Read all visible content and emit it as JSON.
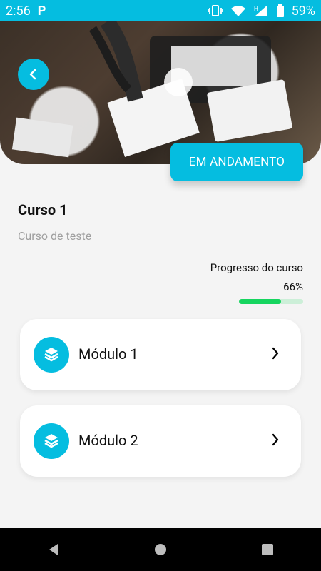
{
  "status_bar": {
    "time": "2:56",
    "app_icon": "P",
    "battery": "59%"
  },
  "header": {
    "back_icon": "chevron-left-icon",
    "image": "business-desk-photo",
    "status_chip": "EM ANDAMENTO"
  },
  "course": {
    "title": "Curso 1",
    "subtitle": "Curso de teste",
    "progress_label": "Progresso do curso",
    "progress_value": "66%",
    "progress_percent": 66
  },
  "modules": [
    {
      "label": "Módulo 1",
      "icon": "layers-icon"
    },
    {
      "label": "Módulo 2",
      "icon": "layers-icon"
    }
  ],
  "colors": {
    "accent": "#05bde0",
    "progress_fill": "#16d55f",
    "progress_track": "#ccefd8"
  }
}
